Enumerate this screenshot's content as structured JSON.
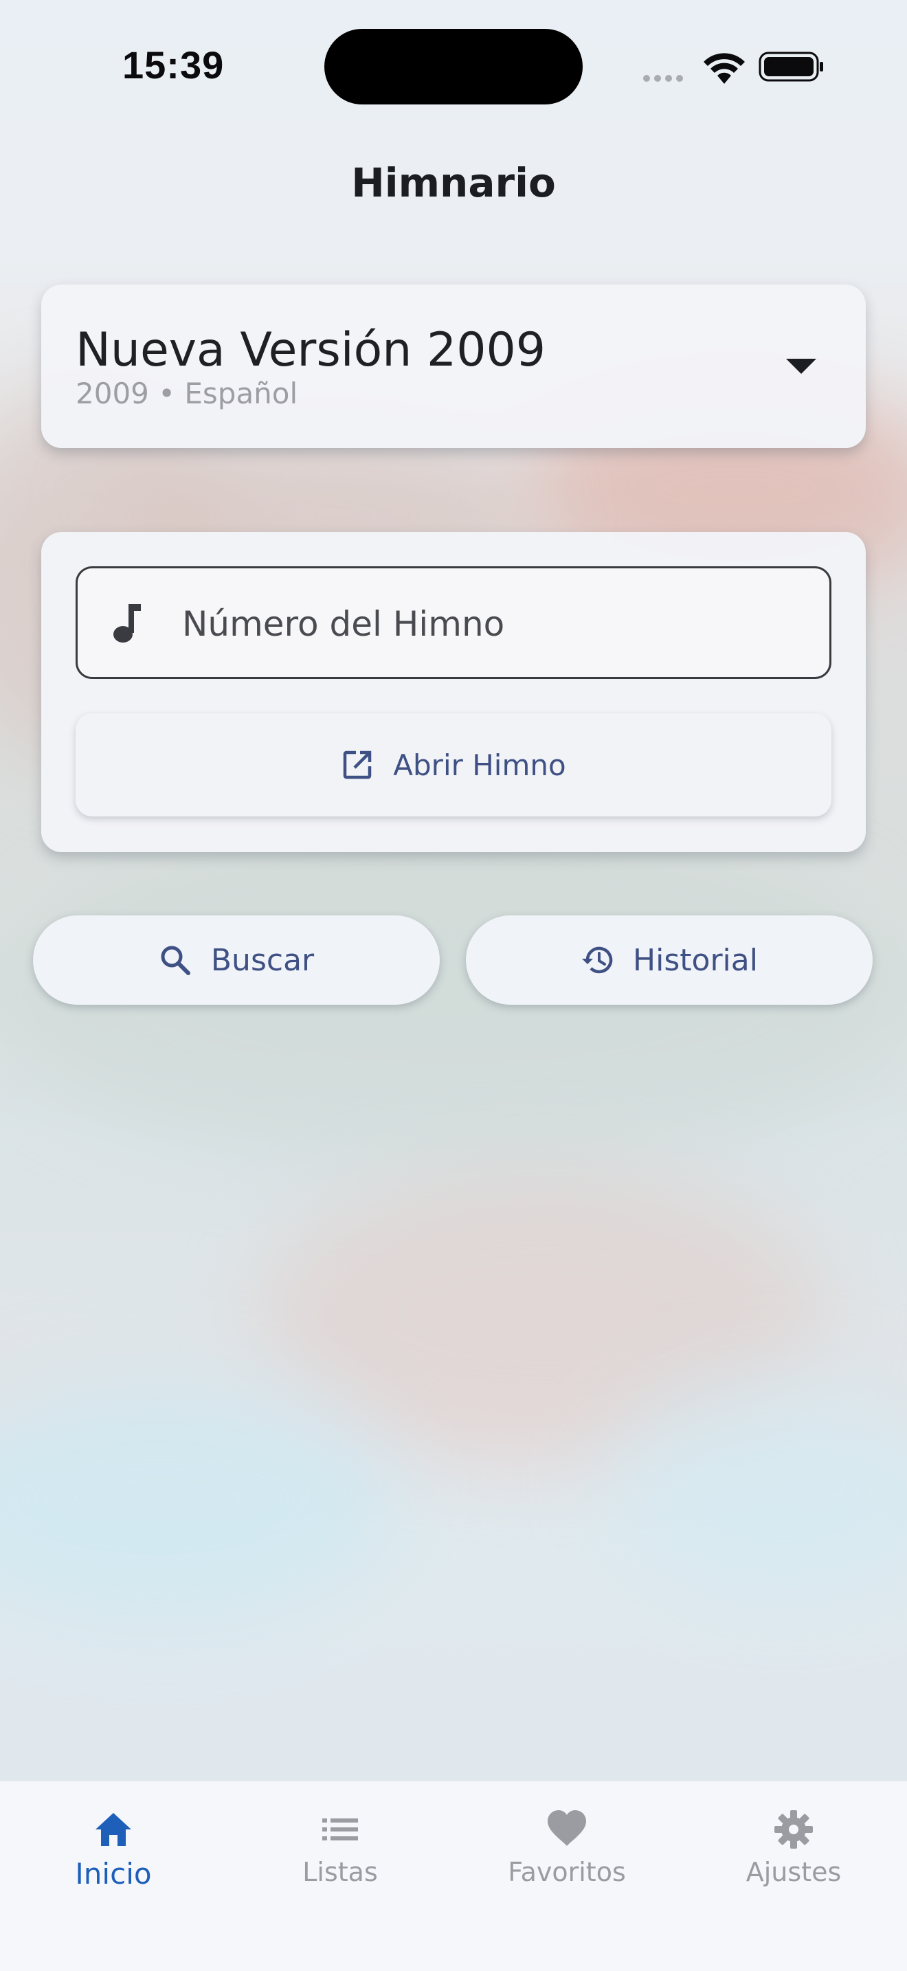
{
  "status_bar": {
    "time": "15:39"
  },
  "header": {
    "title": "Himnario"
  },
  "version_selector": {
    "name": "Nueva Versión 2009",
    "subtitle": "2009 • Español",
    "icon": "arrow-drop-down-icon"
  },
  "hymn_lookup": {
    "input_placeholder": "Número del Himno",
    "input_value": "",
    "input_icon": "music-note-icon",
    "open_button_label": "Abrir Himno",
    "open_button_icon": "open-in-new-icon"
  },
  "actions": {
    "search_label": "Buscar",
    "search_icon": "search-icon",
    "history_label": "Historial",
    "history_icon": "history-icon"
  },
  "bottom_nav": {
    "items": [
      {
        "label": "Inicio",
        "icon": "home-icon",
        "active": true
      },
      {
        "label": "Listas",
        "icon": "list-icon",
        "active": false
      },
      {
        "label": "Favoritos",
        "icon": "heart-icon",
        "active": false
      },
      {
        "label": "Ajustes",
        "icon": "gear-icon",
        "active": false
      }
    ]
  },
  "colors": {
    "accent": "#1d5fb9",
    "button_text": "#3f5184",
    "inactive": "#9a9ca2"
  }
}
